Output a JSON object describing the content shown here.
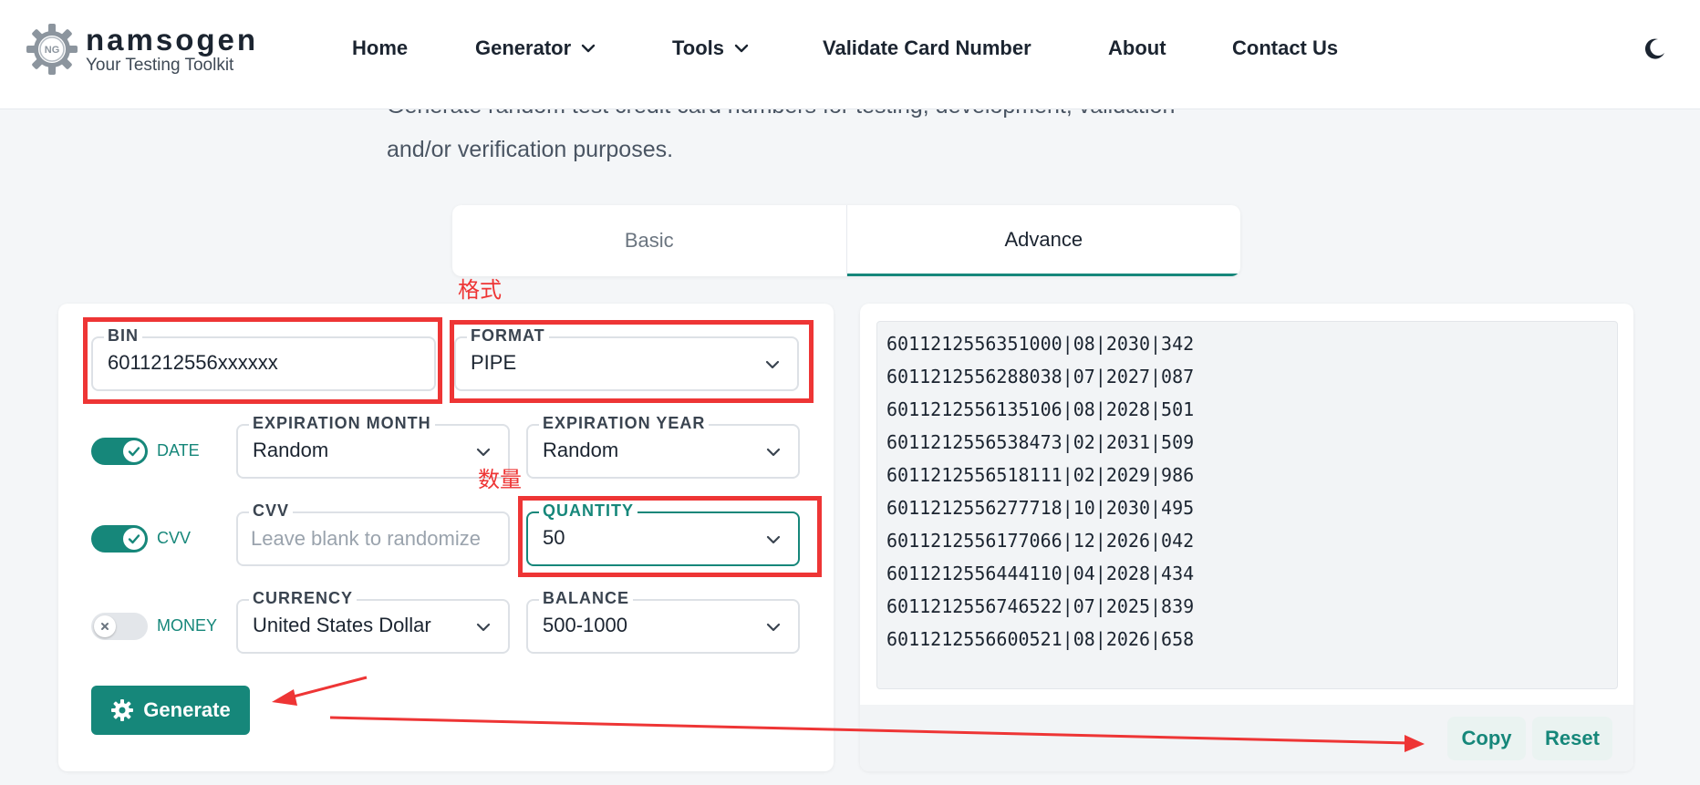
{
  "header": {
    "logo_badge": "NG",
    "logo_name": "namsogen",
    "logo_tagline": "Your Testing Toolkit",
    "nav": [
      "Home",
      "Generator",
      "Tools",
      "Validate Card Number",
      "About",
      "Contact Us"
    ],
    "theme_icon": "moon-icon"
  },
  "intro": {
    "line1": "Generate random test credit card numbers for testing, development, validation",
    "line2": "and/or verification purposes."
  },
  "tabs": {
    "basic": "Basic",
    "advance": "Advance",
    "active": "Advance"
  },
  "form": {
    "bin": {
      "label": "BIN",
      "value": "6011212556xxxxxx"
    },
    "format": {
      "label": "FORMAT",
      "value": "PIPE"
    },
    "date_toggle": {
      "label": "DATE",
      "on": true
    },
    "exp_month": {
      "label": "EXPIRATION MONTH",
      "value": "Random"
    },
    "exp_year": {
      "label": "EXPIRATION YEAR",
      "value": "Random"
    },
    "cvv_toggle": {
      "label": "CVV",
      "on": true
    },
    "cvv": {
      "label": "CVV",
      "placeholder": "Leave blank to randomize"
    },
    "quantity": {
      "label": "QUANTITY",
      "value": "50"
    },
    "money_toggle": {
      "label": "MONEY",
      "on": false
    },
    "currency": {
      "label": "CURRENCY",
      "value": "United States Dollar"
    },
    "balance": {
      "label": "BALANCE",
      "value": "500-1000"
    },
    "generate_label": "Generate"
  },
  "output": {
    "lines": [
      "6011212556351000|08|2030|342",
      "6011212556288038|07|2027|087",
      "6011212556135106|08|2028|501",
      "6011212556538473|02|2031|509",
      "6011212556518111|02|2029|986",
      "6011212556277718|10|2030|495",
      "6011212556177066|12|2026|042",
      "6011212556444110|04|2028|434",
      "6011212556746522|07|2025|839",
      "6011212556600521|08|2026|658"
    ],
    "copy_label": "Copy",
    "reset_label": "Reset"
  },
  "annotations": {
    "format_note": "格式",
    "quantity_note": "数量"
  },
  "colors": {
    "accent": "#16877a",
    "annotation": "#ee3535"
  }
}
